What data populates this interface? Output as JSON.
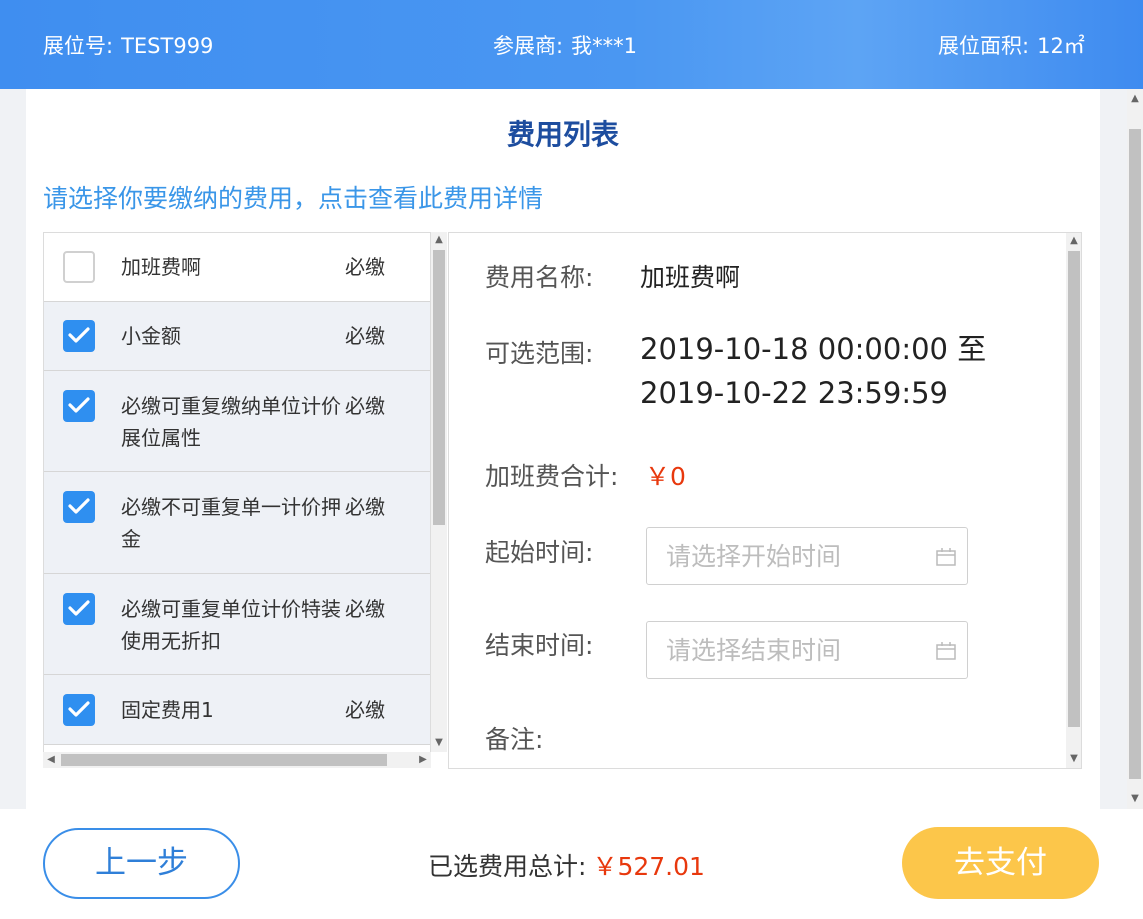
{
  "header": {
    "booth_no_label": "展位号:",
    "booth_no_value": "TEST999",
    "exhibitor_label": "参展商:",
    "exhibitor_value": "我***1",
    "area_label": "展位面积:",
    "area_value": "12㎡"
  },
  "page": {
    "title": "费用列表",
    "hint": "请选择你要缴纳的费用，点击查看此费用详情"
  },
  "fees": [
    {
      "name": "加班费啊",
      "tag": "必缴",
      "checked": false
    },
    {
      "name": "小金额",
      "tag": "必缴",
      "checked": true
    },
    {
      "name": "必缴可重复缴纳单位计价展位属性",
      "tag": "必缴",
      "checked": true
    },
    {
      "name": "必缴不可重复单一计价押金",
      "tag": "必缴",
      "checked": true
    },
    {
      "name": "必缴可重复单位计价特装使用无折扣",
      "tag": "必缴",
      "checked": true
    },
    {
      "name": "固定费用1",
      "tag": "必缴",
      "checked": true
    }
  ],
  "detail": {
    "name_label": "费用名称:",
    "name_value": "加班费啊",
    "range_label": "可选范围:",
    "range_line1": "2019-10-18 00:00:00 至",
    "range_line2": "2019-10-22 23:59:59",
    "sum_label": "加班费合计:",
    "sum_value": "￥0",
    "start_label": "起始时间:",
    "start_placeholder": "请选择开始时间",
    "end_label": "结束时间:",
    "end_placeholder": "请选择结束时间",
    "note_label": "备注:"
  },
  "footer": {
    "prev_label": "上一步",
    "total_label": "已选费用总计:",
    "total_value": "￥527.01",
    "pay_label": "去支付"
  },
  "colors": {
    "header_blue": "#4a97f2",
    "title_blue": "#1d4d9f",
    "hint_blue": "#3a96e8",
    "checkbox_blue": "#2f8ff0",
    "price_red": "#e8380d",
    "pay_yellow": "#fcc64a"
  }
}
